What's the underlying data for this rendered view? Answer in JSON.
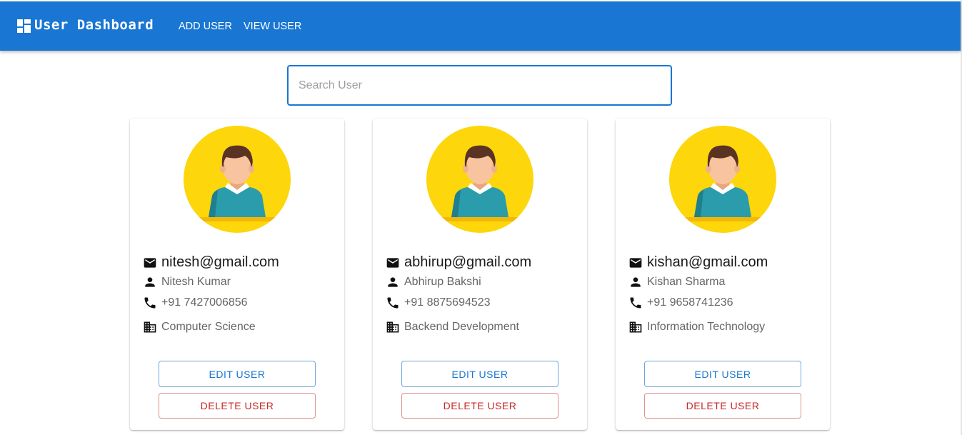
{
  "header": {
    "title": "User Dashboard",
    "brand_icon": "dashboard-icon",
    "nav": [
      {
        "label": "ADD USER"
      },
      {
        "label": "VIEW USER"
      }
    ]
  },
  "search": {
    "placeholder": "Search User",
    "value": ""
  },
  "users": [
    {
      "email": "nitesh@gmail.com",
      "name": "Nitesh Kumar",
      "phone": "+91 7427006856",
      "department": "Computer Science",
      "edit_label": "EDIT USER",
      "delete_label": "DELETE USER"
    },
    {
      "email": "abhirup@gmail.com",
      "name": "Abhirup Bakshi",
      "phone": "+91 8875694523",
      "department": "Backend Development",
      "edit_label": "EDIT USER",
      "delete_label": "DELETE USER"
    },
    {
      "email": "kishan@gmail.com",
      "name": "Kishan Sharma",
      "phone": "+91 9658741236",
      "department": "Information Technology",
      "edit_label": "EDIT USER",
      "delete_label": "DELETE USER"
    }
  ],
  "icons": {
    "email": "email-icon",
    "name": "person-icon",
    "phone": "phone-icon",
    "department": "business-icon",
    "avatar": "user-avatar"
  },
  "colors": {
    "primary": "#1976d2",
    "error": "#c62828",
    "avatar_bg": "#fdd60b"
  }
}
